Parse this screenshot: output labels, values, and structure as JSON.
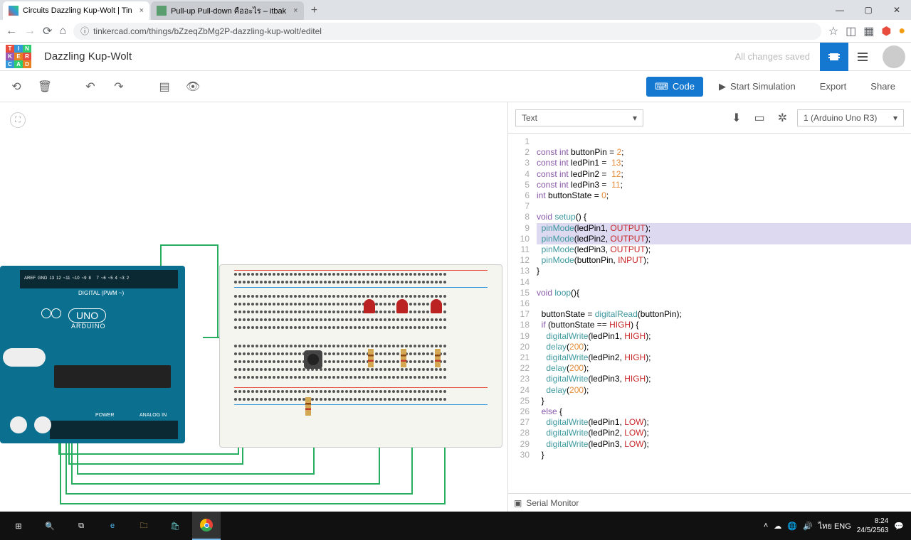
{
  "browser": {
    "tabs": [
      {
        "title": "Circuits Dazzling Kup-Wolt | Tin"
      },
      {
        "title": "Pull-up Pull-down คืออะไร – itbak"
      }
    ],
    "url": "tinkercad.com/things/bZzeqZbMg2P-dazzling-kup-wolt/editel"
  },
  "app": {
    "project_name": "Dazzling Kup-Wolt",
    "save_status": "All changes saved",
    "arduino_label": "UNO",
    "arduino_brand": "ARDUINO",
    "digital_label": "DIGITAL (PWM ~)",
    "power_label": "POWER",
    "analog_label": "ANALOG IN"
  },
  "toolbar": {
    "code": "Code",
    "start_sim": "Start Simulation",
    "export": "Export",
    "share": "Share"
  },
  "code_panel": {
    "view_mode": "Text",
    "device": "1 (Arduino Uno R3)",
    "serial_monitor": "Serial Monitor"
  },
  "code_lines": [
    {
      "n": 1,
      "html": ""
    },
    {
      "n": 2,
      "html": "<span class='kw'>const</span> <span class='type'>int</span> buttonPin = <span class='num'>2</span>;"
    },
    {
      "n": 3,
      "html": "<span class='kw'>const</span> <span class='type'>int</span> ledPin1 =  <span class='num'>13</span>;"
    },
    {
      "n": 4,
      "html": "<span class='kw'>const</span> <span class='type'>int</span> ledPin2 =  <span class='num'>12</span>;"
    },
    {
      "n": 5,
      "html": "<span class='kw'>const</span> <span class='type'>int</span> ledPin3 =  <span class='num'>11</span>;"
    },
    {
      "n": 6,
      "html": "<span class='type'>int</span> buttonState = <span class='num'>0</span>;"
    },
    {
      "n": 7,
      "html": ""
    },
    {
      "n": 8,
      "html": "<span class='type'>void</span> <span class='fn'>setup</span>() {"
    },
    {
      "n": 9,
      "hl": true,
      "html": "  <span class='fn'>pinMode</span>(ledPin1, <span class='const'>OUTPUT</span>);"
    },
    {
      "n": 10,
      "hl": true,
      "html": "  <span class='fn'>pinMode</span>(ledPin2, <span class='const'>OUTPUT</span>);"
    },
    {
      "n": 11,
      "html": "  <span class='fn'>pinMode</span>(ledPin3, <span class='const'>OUTPUT</span>);"
    },
    {
      "n": 12,
      "html": "  <span class='fn'>pinMode</span>(buttonPin, <span class='const'>INPUT</span>);"
    },
    {
      "n": 13,
      "html": "}"
    },
    {
      "n": 14,
      "html": ""
    },
    {
      "n": 15,
      "html": "<span class='type'>void</span> <span class='fn'>loop</span>(){"
    },
    {
      "n": 16,
      "html": ""
    },
    {
      "n": 17,
      "html": "  buttonState = <span class='fn'>digitalRead</span>(buttonPin);"
    },
    {
      "n": 18,
      "html": "  <span class='kw'>if</span> (buttonState == <span class='const'>HIGH</span>) {"
    },
    {
      "n": 19,
      "html": "    <span class='fn'>digitalWrite</span>(ledPin1, <span class='const'>HIGH</span>);"
    },
    {
      "n": 20,
      "html": "    <span class='fn'>delay</span>(<span class='num'>200</span>);"
    },
    {
      "n": 21,
      "html": "    <span class='fn'>digitalWrite</span>(ledPin2, <span class='const'>HIGH</span>);"
    },
    {
      "n": 22,
      "html": "    <span class='fn'>delay</span>(<span class='num'>200</span>);"
    },
    {
      "n": 23,
      "html": "    <span class='fn'>digitalWrite</span>(ledPin3, <span class='const'>HIGH</span>);"
    },
    {
      "n": 24,
      "html": "    <span class='fn'>delay</span>(<span class='num'>200</span>);"
    },
    {
      "n": 25,
      "html": "  }"
    },
    {
      "n": 26,
      "html": "  <span class='kw'>else</span> {"
    },
    {
      "n": 27,
      "html": "    <span class='fn'>digitalWrite</span>(ledPin1, <span class='const'>LOW</span>);"
    },
    {
      "n": 28,
      "html": "    <span class='fn'>digitalWrite</span>(ledPin2, <span class='const'>LOW</span>);"
    },
    {
      "n": 29,
      "html": "    <span class='fn'>digitalWrite</span>(ledPin3, <span class='const'>LOW</span>);"
    },
    {
      "n": 30,
      "html": "  }"
    }
  ],
  "taskbar": {
    "lang": "ENG",
    "ime": "ไทย",
    "time": "8:24",
    "date": "24/5/2563"
  }
}
